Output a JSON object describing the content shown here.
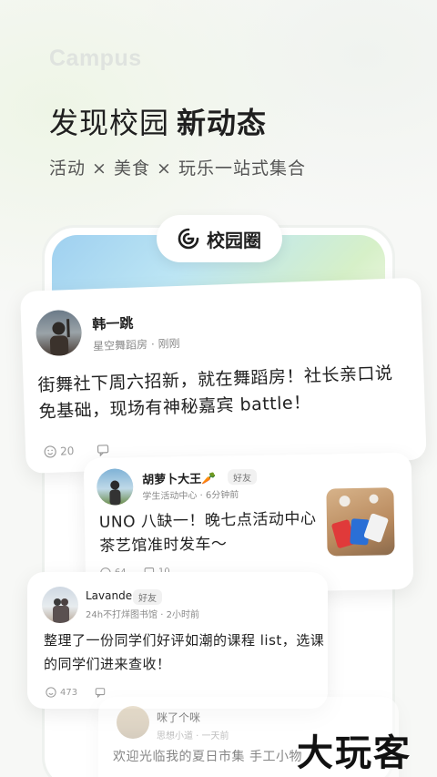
{
  "brand": "Campus",
  "headline": {
    "part1": "发现校园",
    "part2": "新动态"
  },
  "subline": "活动 × 美食 × 玩乐一站式集合",
  "pill": {
    "label": "校园圈",
    "icon": "circle-spiral-icon"
  },
  "posts": [
    {
      "name": "韩一跳",
      "location": "星空舞蹈房",
      "time": "刚刚",
      "text": "街舞社下周六招新，就在舞蹈房！社长亲口说免基础，现场有神秘嘉宾 battle！",
      "likes": "20",
      "comments": "",
      "tag": ""
    },
    {
      "name": "胡萝卜大王🥕",
      "tag": "好友",
      "location": "学生活动中心",
      "time": "6分钟前",
      "text": "UNO 八缺一！晚七点活动中心茶艺馆准时发车～",
      "likes": "64",
      "comments": "10"
    },
    {
      "name": "Lavande",
      "tag": "好友",
      "location": "24h不打烊图书馆",
      "time": "2小时前",
      "text": "整理了一份同学们好评如潮的课程 list，选课的同学们进来查收！",
      "likes": "473",
      "comments": ""
    },
    {
      "name": "咪了个咪",
      "tag": "",
      "location": "思想小道",
      "time": "一天前",
      "text": "欢迎光临我的夏日市集 手工小物",
      "likes": "",
      "comments": ""
    }
  ],
  "watermark": "大玩客",
  "colors": {
    "accent_green": "#d6f0c8",
    "sky": "#9fd0f0",
    "text": "#1f1f1f",
    "muted": "#8a8a8a"
  }
}
